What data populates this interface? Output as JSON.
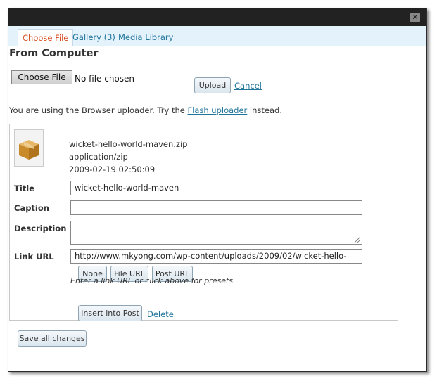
{
  "tabs": [
    {
      "label": "Choose File"
    },
    {
      "label": "Gallery (3)"
    },
    {
      "label": "Media Library"
    }
  ],
  "upload": {
    "heading": "From Computer",
    "choose_label": "Choose File",
    "no_file_text": "No file chosen",
    "upload_label": "Upload",
    "cancel_label": "Cancel"
  },
  "uploader_msg": {
    "prefix": "You are using the Browser uploader. Try the ",
    "link": "Flash uploader",
    "suffix": " instead."
  },
  "file": {
    "name": "wicket-hello-world-maven.zip",
    "mime": "application/zip",
    "date": "2009-02-19 02:50:09"
  },
  "fields": {
    "title_label": "Title",
    "title_value": "wicket-hello-world-maven",
    "caption_label": "Caption",
    "caption_value": "",
    "description_label": "Description",
    "description_value": "",
    "link_label": "Link URL",
    "link_value": "http://www.mkyong.com/wp-content/uploads/2009/02/wicket-hello-"
  },
  "presets": {
    "none": "None",
    "file_url": "File URL",
    "post_url": "Post URL",
    "hint": "Enter a link URL or click above for presets."
  },
  "actions": {
    "insert_label": "Insert into Post",
    "delete_label": "Delete",
    "save_all_label": "Save all changes"
  },
  "colors": {
    "tab_active": "#d54e21",
    "link": "#21759b",
    "tabbar_bg": "#e4f2fc",
    "titlebar_bg": "#222222"
  }
}
